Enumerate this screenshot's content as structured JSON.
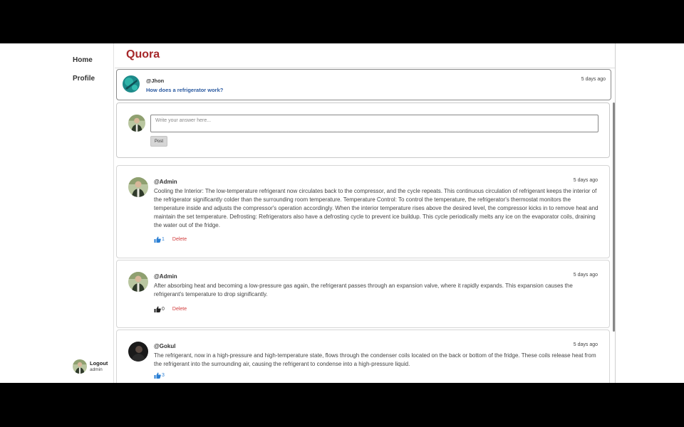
{
  "sidebar": {
    "nav": [
      {
        "label": "Home"
      },
      {
        "label": "Profile"
      }
    ],
    "user": {
      "logout_label": "Logout",
      "username": "admin"
    }
  },
  "header": {
    "brand": "Quora"
  },
  "question": {
    "user": "@Jhon",
    "time": "5 days ago",
    "text": "How does a refrigerator work?"
  },
  "answer_form": {
    "placeholder": "Write your answer here...",
    "post_label": "Post"
  },
  "answers": [
    {
      "user": "@Admin",
      "time": "5 days ago",
      "text": "Cooling the Interior: The low-temperature refrigerant now circulates back to the compressor, and the cycle repeats. This continuous circulation of refrigerant keeps the interior of the refrigerator significantly colder than the surrounding room temperature. Temperature Control: To control the temperature, the refrigerator's thermostat monitors the temperature inside and adjusts the compressor's operation accordingly. When the interior temperature rises above the desired level, the compressor kicks in to remove heat and maintain the set temperature. Defrosting: Refrigerators also have a defrosting cycle to prevent ice buildup. This cycle periodically melts any ice on the evaporator coils, draining the water out of the fridge.",
      "likes": "1",
      "liked": true,
      "delete_label": "Delete"
    },
    {
      "user": "@Admin",
      "time": "5 days ago",
      "text": "After absorbing heat and becoming a low-pressure gas again, the refrigerant passes through an expansion valve, where it rapidly expands. This expansion causes the refrigerant's temperature to drop significantly.",
      "likes": "0",
      "liked": false,
      "delete_label": "Delete"
    },
    {
      "user": "@Gokul",
      "time": "5 days ago",
      "text": "The refrigerant, now in a high-pressure and high-temperature state, flows through the condenser coils located on the back or bottom of the fridge. These coils release heat from the refrigerant into the surrounding air, causing the refrigerant to condense into a high-pressure liquid.",
      "likes": "3",
      "liked": true
    }
  ],
  "colors": {
    "brand": "#a6282a",
    "question_link": "#2b5aa0",
    "delete": "#d23c3c",
    "like_active": "#2a7fd4",
    "like_inactive": "#222222"
  },
  "icons": {
    "like": "thumbs-up-icon",
    "avatar_jhon": "avatar-teal",
    "avatar_admin": "avatar-person",
    "avatar_gokul": "avatar-dark"
  }
}
